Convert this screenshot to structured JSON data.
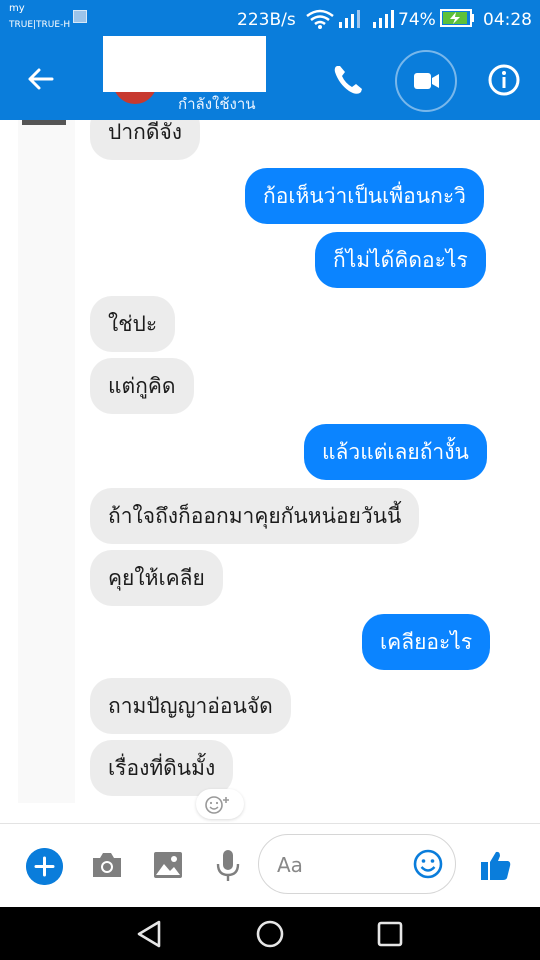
{
  "status_bar": {
    "carrier_line1": "my",
    "carrier_line2": "TRUE|TRUE-H",
    "net_speed": "223B/s",
    "battery_percent": "74%",
    "time": "04:28"
  },
  "header": {
    "presence": "กำลังใช้งาน",
    "icons": [
      "back-arrow-icon",
      "phone-icon",
      "video-call-icon",
      "info-icon"
    ]
  },
  "messages": [
    {
      "side": "in",
      "text": "ปากดีจัง"
    },
    {
      "side": "out",
      "text": "ก้อเห็นว่าเป็นเพื่อนกะวิ"
    },
    {
      "side": "out",
      "text": "ก็ไม่ได้คิดอะไร"
    },
    {
      "side": "in",
      "text": "ใช่ปะ"
    },
    {
      "side": "in",
      "text": "แต่กูคิด"
    },
    {
      "side": "out",
      "text": "แล้วแต่เลยถ้างั้น"
    },
    {
      "side": "in",
      "text": "ถ้าใจถึงก็ออกมาคุยกันหน่อยวันนี้"
    },
    {
      "side": "in",
      "text": "คุยให้เคลีย"
    },
    {
      "side": "out",
      "text": "เคลียอะไร"
    },
    {
      "side": "in",
      "text": "ถามปัญญาอ่อนจัด"
    },
    {
      "side": "in",
      "text": "เรื่องที่ดินมั้ง"
    }
  ],
  "composer": {
    "placeholder": "Aa",
    "icons": [
      "plus-icon",
      "camera-icon",
      "image-icon",
      "microphone-icon",
      "emoji-icon",
      "thumbs-up-icon"
    ]
  },
  "colors": {
    "brand": "#0a7ddb",
    "outgoing_bubble": "#0b84ff",
    "incoming_bubble": "#ececec"
  }
}
